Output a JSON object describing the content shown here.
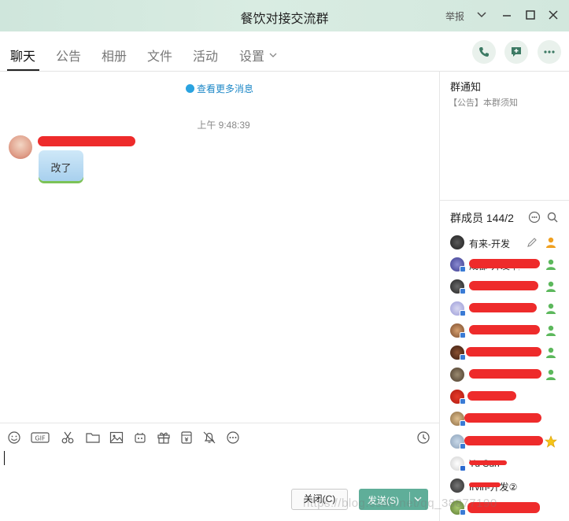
{
  "window": {
    "title": "餐饮对接交流群",
    "report_label": "举报",
    "icons": [
      "chevron-down-icon",
      "minimize-icon",
      "maximize-icon",
      "close-icon"
    ]
  },
  "tabs": [
    {
      "label": "聊天",
      "active": true
    },
    {
      "label": "公告",
      "active": false
    },
    {
      "label": "相册",
      "active": false
    },
    {
      "label": "文件",
      "active": false
    },
    {
      "label": "活动",
      "active": false
    },
    {
      "label": "设置",
      "active": false
    }
  ],
  "header_actions": [
    "phone-icon",
    "add-chat-icon",
    "more-icon"
  ],
  "chat": {
    "more_messages_label": "查看更多消息",
    "timestamp": "上午 9:48:39",
    "messages": [
      {
        "sender": "",
        "text": "改了"
      }
    ]
  },
  "notice": {
    "heading": "群通知",
    "summary": "【公告】本群须知"
  },
  "members": {
    "heading": "群成员 144/2",
    "list": [
      {
        "name": "有来-开发",
        "role_icon": "admin-icon"
      },
      {
        "name": "成都-开发-阿",
        "role_icon": "member-icon"
      },
      {
        "name": "",
        "role_icon": "member-icon"
      },
      {
        "name": "",
        "role_icon": "member-icon"
      },
      {
        "name": "",
        "role_icon": "member-icon"
      },
      {
        "name": "",
        "role_icon": "member-icon"
      },
      {
        "name": "",
        "role_icon": "member-icon"
      },
      {
        "name": "",
        "role_icon": ""
      },
      {
        "name": "",
        "role_icon": ""
      },
      {
        "name": "",
        "role_icon": "star-icon"
      },
      {
        "name": "Yu Sun",
        "role_icon": ""
      },
      {
        "name": "Irvin-开发②",
        "role_icon": ""
      },
      {
        "name": "",
        "role_icon": ""
      }
    ]
  },
  "toolbar": {
    "icons": [
      "emoji-icon",
      "gif-icon",
      "scissors-icon",
      "folder-icon",
      "image-icon",
      "shake-icon",
      "gift-icon",
      "red-packet-icon",
      "bell-off-icon",
      "more-icon",
      "history-icon"
    ]
  },
  "composer": {
    "close_label": "关闭(C)",
    "send_label": "发送(S)"
  },
  "watermark": "https://blog.csdn.net/qq_38877190",
  "colors": {
    "accent": "#5fae99",
    "link": "#1e88c7",
    "scribble": "#ee2b2b"
  }
}
